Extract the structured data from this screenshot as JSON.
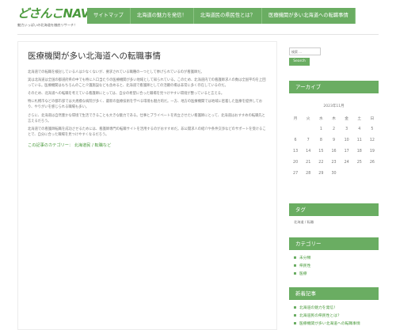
{
  "header": {
    "logo": "どさんこNAVI",
    "tagline": "魅力いっぱいの北海道を徹底リサーチ！"
  },
  "nav": {
    "items": [
      {
        "label": "サイトマップ"
      },
      {
        "label": "北海道の魅力を発信！"
      },
      {
        "label": "北海道民の県民性とは？"
      },
      {
        "label": "医療機関が多い北海道への転職事情"
      }
    ]
  },
  "post": {
    "title": "医療機関が多い北海道への転職事情",
    "paragraphs": [
      "北海道での転職を検討している人は少なくないが、要求されている職種の一つとして挙げられているのが看護師だ。",
      "実は北海道は全国の都道府県の中でも特に人口当たりの医療機関が多い地域として知られている。このため、北海道内での看護師求人の数は全国平均を上回っている。医療機関はもちろんのこと介護施設なども含めると、北海道で看護師としての活躍の場は非常に多く存在しているのだ。",
      "そのため、北海道への転職を考えている看護師にとっては、自分の希望に合った職場を見つけやすい環境が整っていると言える。",
      "特に札幌市などの都市部では大規模な病院が多く、最新の医療技術を学べる環境も魅力的だ。一方、地方の医療機関では地域に密着した医療を提供しており、やりがいを感じられる職場も多い。",
      "さらに、北海道は自然豊かな環境で生活できることも大きな魅力である。仕事とプライベートを両立させたい看護師にとって、北海道はおすすめの転職先と言えるだろう。",
      "北海道での看護師転職を成功させるためには、看護師専門の転職サイトを活用するのがおすすめだ。非公開求人の紹介や条件交渉などのサポートを受けることで、自分に合った職場を見つけやすくなるだろう。"
    ],
    "meta_prefix": "この記事のカテゴリー：",
    "meta_tags": "北海道民 / 転職など"
  },
  "sidebar": {
    "search_placeholder": "検索 ...",
    "search_button": "Search",
    "archive_title": "アーカイブ",
    "calendar_caption": "2023年11月",
    "calendar_headers": [
      "月",
      "火",
      "水",
      "木",
      "金",
      "土",
      "日"
    ],
    "calendar_rows": [
      [
        "",
        "",
        "1",
        "2",
        "3",
        "4",
        "5"
      ],
      [
        "6",
        "7",
        "8",
        "9",
        "10",
        "11",
        "12"
      ],
      [
        "13",
        "14",
        "15",
        "16",
        "17",
        "18",
        "19"
      ],
      [
        "20",
        "21",
        "22",
        "23",
        "24",
        "25",
        "26"
      ],
      [
        "27",
        "28",
        "29",
        "30",
        "",
        "",
        ""
      ]
    ],
    "tag_title": "タグ",
    "tag_text": "北海道 / 転職",
    "category_title": "カテゴリー",
    "categories": [
      {
        "label": "未分類"
      },
      {
        "label": "県民性"
      },
      {
        "label": "医療"
      }
    ],
    "recent_title": "新着記事",
    "recent_posts": [
      {
        "label": "北海道の魅力を発信！"
      },
      {
        "label": "北海道民の県民性とは？"
      },
      {
        "label": "医療機関が多い北海道への転職事情"
      }
    ]
  },
  "colors": {
    "accent": "#6aad62",
    "logo": "#4a9a3c"
  }
}
